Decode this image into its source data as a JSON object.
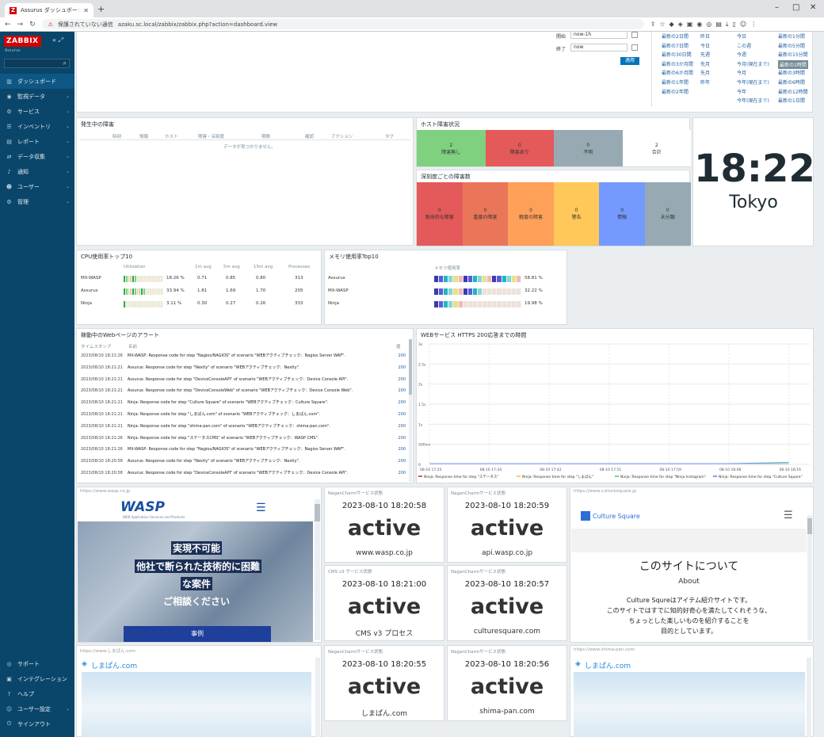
{
  "browser": {
    "tab_title": "Assurus ダッシュボード",
    "url_warning": "保護されていない通信",
    "url": "azaku.sc.local/zabbix/zabbix.php?action=dashboard.view"
  },
  "sidebar": {
    "logo": "ZABBIX",
    "subtitle": "Assurus",
    "items": [
      {
        "label": "ダッシュボード"
      },
      {
        "label": "監視データ"
      },
      {
        "label": "サービス"
      },
      {
        "label": "インベントリ"
      },
      {
        "label": "レポート"
      },
      {
        "label": "データ収集"
      },
      {
        "label": "通知"
      },
      {
        "label": "ユーザー"
      },
      {
        "label": "管理"
      }
    ],
    "bottom_items": [
      {
        "label": "サポート"
      },
      {
        "label": "インテグレーション"
      },
      {
        "label": "ヘルプ"
      },
      {
        "label": "ユーザー設定"
      },
      {
        "label": "サインアウト"
      }
    ]
  },
  "filter": {
    "from_label": "開始",
    "from_value": "now-1h",
    "to_label": "終了",
    "to_value": "now",
    "apply_label": "適用",
    "ranges": [
      [
        "最新の2日間",
        "昨日",
        "今日",
        "最新の1分間"
      ],
      [
        "最新の7日間",
        "今日",
        "この週",
        "最新の5分間"
      ],
      [
        "最新の30日間",
        "先週",
        "今週",
        "最新の15分間"
      ],
      [
        "最新の3か月間",
        "先月",
        "今月(現在まで)",
        "最新の1時間"
      ],
      [
        "最新の6か月間",
        "先月",
        "今月",
        "最新の3時間"
      ],
      [
        "最新の1年間",
        "昨年",
        "今年(現在まで)",
        "最新の6時間"
      ],
      [
        "最新の2年間",
        "",
        "今年",
        "最新の12時間"
      ],
      [
        "",
        "",
        "今年(現在まで)",
        "最新の1日間"
      ]
    ]
  },
  "problems": {
    "title": "発生中の障害",
    "columns": [
      "時刻",
      "情報",
      "ホスト",
      "障害・深刻度",
      "期間",
      "確認",
      "アクション",
      "タグ"
    ],
    "empty": "データが見つかりません。"
  },
  "host_status": {
    "title": "ホスト障害状況",
    "cells": [
      {
        "count": "2",
        "label": "障害無し",
        "color": "#7fd17f"
      },
      {
        "count": "0",
        "label": "障害あり",
        "color": "#e45959"
      },
      {
        "count": "0",
        "label": "不明",
        "color": "#97aab3"
      },
      {
        "count": "2",
        "label": "合計",
        "color": "#ffffff"
      }
    ]
  },
  "severity": {
    "title": "深刻度ごとの障害数",
    "cells": [
      {
        "count": "0",
        "label": "致命的な障害",
        "color": "#e45959"
      },
      {
        "count": "0",
        "label": "重度の障害",
        "color": "#e97659"
      },
      {
        "count": "0",
        "label": "軽度の障害",
        "color": "#ffa059"
      },
      {
        "count": "0",
        "label": "警告",
        "color": "#ffc859"
      },
      {
        "count": "0",
        "label": "情報",
        "color": "#7499ff"
      },
      {
        "count": "0",
        "label": "未分類",
        "color": "#97aab3"
      }
    ]
  },
  "clock": {
    "time": "18:22",
    "tz": "Tokyo"
  },
  "cpu": {
    "title": "CPU使用率トップ10",
    "columns": [
      "Utilization",
      "1m avg",
      "5m avg",
      "15m avg",
      "Processes"
    ],
    "rows": [
      {
        "host": "MX-WASP",
        "pct": "18.26 %",
        "v1": "0.71",
        "v5": "0.85",
        "v15": "0.80",
        "proc": "313",
        "fill": 0.18
      },
      {
        "host": "Assurus",
        "pct": "33.94 %",
        "v1": "1.81",
        "v5": "1.69",
        "v15": "1.70",
        "proc": "205",
        "fill": 0.34
      },
      {
        "host": "Ninja",
        "pct": "3.11 %",
        "v1": "0.30",
        "v5": "0.27",
        "v15": "0.26",
        "proc": "333",
        "fill": 0.03
      }
    ]
  },
  "mem": {
    "title": "メモリ使用率Top10",
    "column": "メモリ使用率",
    "rows": [
      {
        "host": "Assurus",
        "pct": "58.81 %",
        "fill": 0.59
      },
      {
        "host": "MX-WASP",
        "pct": "32.22 %",
        "fill": 0.32
      },
      {
        "host": "Ninja",
        "pct": "19.98 %",
        "fill": 0.2
      }
    ]
  },
  "webmon": {
    "title": "稼動中のWebページのアラート",
    "col_time": "タイムスタンプ",
    "col_name": "名前",
    "col_value": "値",
    "rows": [
      {
        "t": "2023/08/10 18:21:26",
        "msg": "MX-WASP: Response code for step \"Nagios/NAGIOS\" of scenario \"WEBアクティブチェック：Nagios Server WAF\".",
        "v": "200"
      },
      {
        "t": "2023/08/10 18:21:21",
        "msg": "Assurus: Response code for step \"Nextly\" of scenario \"WEBアクティブチェック：Nextly\".",
        "v": "200"
      },
      {
        "t": "2023/08/10 18:21:21",
        "msg": "Assurus: Response code for step \"DeviceConsoleAPI\" of scenario \"WEBアクティブチェック：Device Console API\".",
        "v": "200"
      },
      {
        "t": "2023/08/10 18:21:21",
        "msg": "Assurus: Response code for step \"DeviceConsoleWeb\" of scenario \"WEBアクティブチェック：Device Console Web\".",
        "v": "200"
      },
      {
        "t": "2023/08/10 18:21:21",
        "msg": "Ninja: Response code for step \"Culture Square\" of scenario \"WEBアクティブチェック：Culture Square\".",
        "v": "200"
      },
      {
        "t": "2023/08/10 18:21:21",
        "msg": "Ninja: Response code for step \"しまぱん.com\" of scenario \"WEBアクティブチェック：しまぱん.com\".",
        "v": "200"
      },
      {
        "t": "2023/08/10 18:21:21",
        "msg": "Ninja: Response code for step \"shima-pan.com\" of scenario \"WEBアクティブチェック：shima-pan.com\".",
        "v": "200"
      },
      {
        "t": "2023/08/10 18:21:26",
        "msg": "Ninja: Response code for step \"ステータスCMS\" of scenario \"WEBアクティブチェック：WASP CMS\".",
        "v": "200"
      },
      {
        "t": "2023/08/10 18:21:26",
        "msg": "MX-WASP: Response code for step \"Nagios/NAGIOS\" of scenario \"WEBアクティブチェック：Nagios Server WAF\".",
        "v": "200"
      },
      {
        "t": "2023/08/10 18:20:58",
        "msg": "Assurus: Response code for step \"Nextly\" of scenario \"WEBアクティブチェック：Nextly\".",
        "v": "200"
      },
      {
        "t": "2023/08/10 18:20:58",
        "msg": "Assurus: Response code for step \"DeviceConsoleAPI\" of scenario \"WEBアクティブチェック：Device Console API\".",
        "v": "200"
      }
    ]
  },
  "graph": {
    "title": "WEBサービス HTTPS 200応答までの時間",
    "y_ticks": [
      "3s",
      "2.5s",
      "2s",
      "1.5s",
      "1s",
      "500ms",
      "0"
    ],
    "x_ticks": [
      "08-10 17:25",
      "08-10 17:34",
      "08-10 17:42",
      "08-10 17:51",
      "08-10 17:59",
      "08-10 18:08",
      "08-10 18:16"
    ],
    "legend": [
      {
        "name": "Ninja: Response time for step \"ステータス\"",
        "color": "#e45959"
      },
      {
        "name": "Ninja: Response time for step \"しまぱん\"",
        "color": "#ffc859"
      },
      {
        "name": "Ninja: Response time for step \"Ninja Instagram\"",
        "color": "#7fd17f"
      },
      {
        "name": "Ninja: Response time for step \"Culture Square\"",
        "color": "#7499ff"
      }
    ]
  },
  "chart_data": {
    "type": "line",
    "title": "WEBサービス HTTPS 200応答までの時間",
    "ylabel": "",
    "xlabel": "",
    "ylim": [
      0,
      3
    ],
    "x": [
      "08-10 17:25",
      "08-10 17:34",
      "08-10 17:42",
      "08-10 17:51",
      "08-10 17:59",
      "08-10 18:08",
      "08-10 18:16"
    ],
    "series": [
      {
        "name": "Ninja: Response time for step \"ステータス\"",
        "values": [
          0.02,
          0.02,
          0.02,
          0.02,
          0.02,
          0.02,
          0.02
        ]
      },
      {
        "name": "Ninja: Response time for step \"しまぱん\"",
        "values": [
          0.02,
          0.02,
          0.02,
          0.02,
          0.02,
          0.02,
          0.02
        ]
      },
      {
        "name": "Ninja: Response time for step \"Ninja Instagram\"",
        "values": [
          0.02,
          0.02,
          0.02,
          0.02,
          0.02,
          0.02,
          0.02
        ]
      },
      {
        "name": "Ninja: Response time for step \"Culture Square\"",
        "values": [
          0.02,
          0.02,
          0.02,
          0.02,
          0.02,
          0.02,
          0.05
        ]
      }
    ]
  },
  "tiles": [
    {
      "header": "NaganCharmサービス状態",
      "date": "2023-08-10 18:20:58",
      "status": "active",
      "foot": "www.wasp.co.jp"
    },
    {
      "header": "NaganCharmサービス状態",
      "date": "2023-08-10 18:20:59",
      "status": "active",
      "foot": "api.wasp.co.jp"
    },
    {
      "header": "CMS v3 サービス状態",
      "date": "2023-08-10 18:21:00",
      "status": "active",
      "foot": "CMS v3 プロセス"
    },
    {
      "header": "NaganCharmサービス状態",
      "date": "2023-08-10 18:20:57",
      "status": "active",
      "foot": "culturesquare.com"
    },
    {
      "header": "NaganCharmサービス状態",
      "date": "2023-08-10 18:20:55",
      "status": "active",
      "foot": "しまぱん.com"
    },
    {
      "header": "NaganCharmサービス状態",
      "date": "2023-08-10 18:20:56",
      "status": "active",
      "foot": "shima-pan.com"
    }
  ],
  "sites": {
    "wasp": {
      "url": "https://www.wasp.co.jp",
      "logo": "WASP",
      "logo_sub": "WEB Application Services and Products",
      "lines": [
        "実現不可能",
        "他社で断られた技術的に困難",
        "な案件",
        "ご相談ください"
      ],
      "button": "事例"
    },
    "culture": {
      "url": "https://www.culturesquare.jp",
      "logo": "Culture Square",
      "heading": "このサイトについて",
      "sub": "About",
      "body": [
        "Culture Squreはアイテム紹介サイトです。",
        "このサイトではすでに知的好奇心を満たしてくれそうな、",
        "ちょっとした楽しいものを紹介することを",
        "目的としています。"
      ]
    },
    "shimapan1": {
      "url": "https://www.しまぱん.com",
      "logo": "しまぱん.com"
    },
    "shimapan2": {
      "url": "https://www.shima-pan.com",
      "logo": "しまぱん.com"
    }
  }
}
